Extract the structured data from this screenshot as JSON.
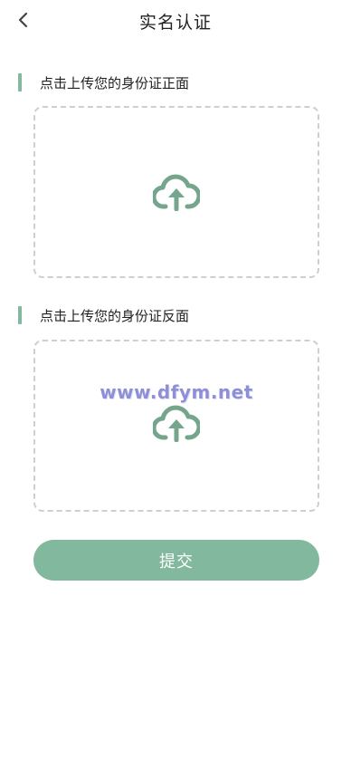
{
  "header": {
    "title": "实名认证",
    "back_icon": "chevron-left-icon"
  },
  "front": {
    "label": "点击上传您的身份证正面",
    "icon": "cloud-upload-icon"
  },
  "back": {
    "label": "点击上传您的身份证反面",
    "icon": "cloud-upload-icon",
    "watermark": "www.dfym.net"
  },
  "submit": {
    "label": "提交"
  },
  "colors": {
    "accent": "#82b89e",
    "icon": "#76a58d",
    "dashed_border": "#cfcfcf",
    "watermark": "#8f8fd8"
  }
}
